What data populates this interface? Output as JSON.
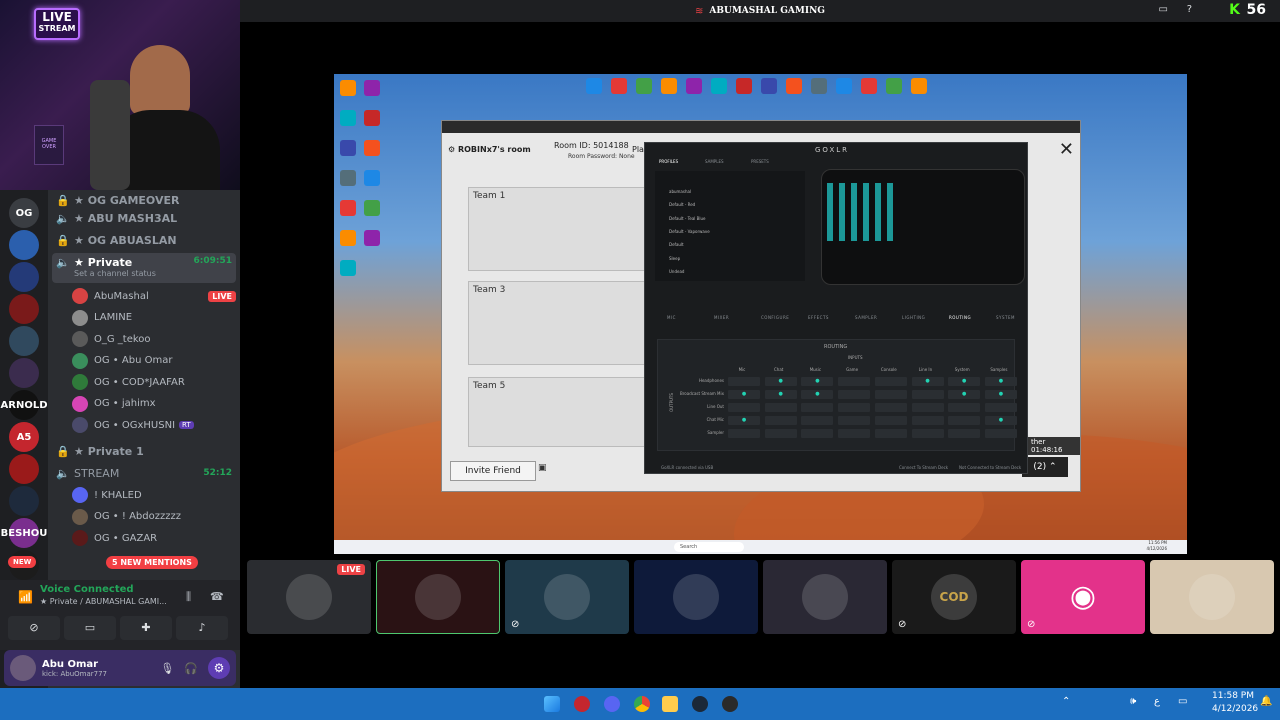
{
  "topbar": {
    "title": "ABUMASHAL GAMING",
    "viewer_count": "56"
  },
  "webcam": {
    "live_badge_line1": "LIVE",
    "live_badge_line2": "STREAM",
    "poster_text": "GAME OVER"
  },
  "servers": [
    {
      "label": "OG",
      "color": "#3a3d42"
    },
    {
      "label": "",
      "color": "#2b5fad",
      "badge": "33"
    },
    {
      "label": "",
      "color": "#243a78",
      "badge": "5"
    },
    {
      "label": "",
      "color": "#7a1a1a",
      "badge": "6"
    },
    {
      "label": "",
      "color": "#30495e"
    },
    {
      "label": "",
      "color": "#3b2c4e"
    },
    {
      "label": "ARNOLD",
      "color": "#111111"
    },
    {
      "label": "A5",
      "color": "#c4262e"
    },
    {
      "label": "",
      "color": "#9a1a1a"
    },
    {
      "label": "",
      "color": "#1e2a3c"
    },
    {
      "label": "BESHOU",
      "color": "#7a2e8e"
    },
    {
      "label": "",
      "color": "#1c1c1c"
    }
  ],
  "new_badge": "NEW",
  "channels": {
    "locked": [
      "★ OG GAMEOVER",
      "★ ABU MASH3AL",
      "★ OG ABUASLAN"
    ],
    "private": {
      "name": "★ Private",
      "time": "6:09:51",
      "status": "Set a channel status"
    },
    "members": [
      {
        "name": "AbuMashal",
        "live": "LIVE",
        "color": "#d84343"
      },
      {
        "name": "LAMINE",
        "color": "#8d8d8d"
      },
      {
        "name": "O_G _tekoo",
        "color": "#5a5a5a"
      },
      {
        "name": "OG • Abu Omar",
        "color": "#3a8e5c"
      },
      {
        "name": "OG • COD*JAAFAR",
        "color": "#2f7a3a"
      },
      {
        "name": "OG • jahimx",
        "color": "#d645b5"
      },
      {
        "name": "OG • OGxHUSNI",
        "color": "#4a4a6a",
        "tag": "RT"
      }
    ],
    "private1": "★ Private 1",
    "stream": {
      "name": "STREAM",
      "time": "52:12"
    },
    "stream_members": [
      {
        "name": "! KHALED",
        "color": "#5865f2"
      },
      {
        "name": "OG • ! Abdozzzzz",
        "color": "#6a5a4a"
      },
      {
        "name": "OG • GAZAR",
        "color": "#5a1a1a"
      }
    ],
    "mentions": "5 NEW MENTIONS"
  },
  "voice": {
    "status": "Voice Connected",
    "channel": "★ Private / ABUMASHAL GAMI..."
  },
  "user": {
    "name": "Abu Omar",
    "subtitle": "kick: AbuOmar777"
  },
  "remote_desktop": {
    "game_window": {
      "room_owner": "ROBINx7's room",
      "room_id": "Room ID: 5014188",
      "room_password": "Room Password: None",
      "play_partial": "Pla",
      "team1": "Team 1",
      "team3": "Team 3",
      "team5": "Team 5",
      "invite": "Invite Friend",
      "timer": "ther 01:48:16",
      "count": "(2)"
    },
    "goxlr": {
      "title": "GOXLR",
      "top_tabs": [
        "PROFILES",
        "SAMPLES",
        "PRESETS"
      ],
      "profiles": [
        "abumashal",
        "Default - Red",
        "Default - Teal Blue",
        "Default - Vaporwave",
        "Default",
        "Sleep",
        "Undead"
      ],
      "bottom_tabs": [
        "MIC",
        "MIXER",
        "CONFIGURE",
        "EFFECTS",
        "SAMPLER",
        "LIGHTING",
        "ROUTING",
        "SYSTEM"
      ],
      "routing_title": "ROUTING",
      "inputs_label": "INPUTS",
      "outputs_label": "OUTPUTS",
      "columns": [
        "Mic",
        "Chat",
        "Music",
        "Game",
        "Console",
        "Line In",
        "System",
        "Samples"
      ],
      "rows": [
        "Headphones",
        "Broadcast Stream Mix",
        "Line Out",
        "Chat Mic",
        "Sampler"
      ],
      "status_left": "GoXLR connected via USB",
      "status_mid": "Connect To Stream Deck",
      "status_right": "Not Connected to Stream Deck"
    },
    "taskbar_search": "Search",
    "taskbar_time": "11:56 PM",
    "taskbar_date": "4/12/2026"
  },
  "tiles": [
    {
      "label": "LIVE",
      "bg": "#2a2c30"
    },
    {
      "label": "",
      "bg": "#2a1214"
    },
    {
      "label": "",
      "bg": "#1f3a4a"
    },
    {
      "label": "",
      "bg": "#0e1a3a"
    },
    {
      "label": "",
      "bg": "#2a2834"
    },
    {
      "label": "COD",
      "bg": "#1a1a1a"
    },
    {
      "label": "",
      "bg": "#e3328a"
    },
    {
      "label": "",
      "bg": "#d8c8b0"
    }
  ],
  "taskbar": {
    "time": "11:58 PM",
    "date": "4/12/2026",
    "lang": "ع"
  }
}
